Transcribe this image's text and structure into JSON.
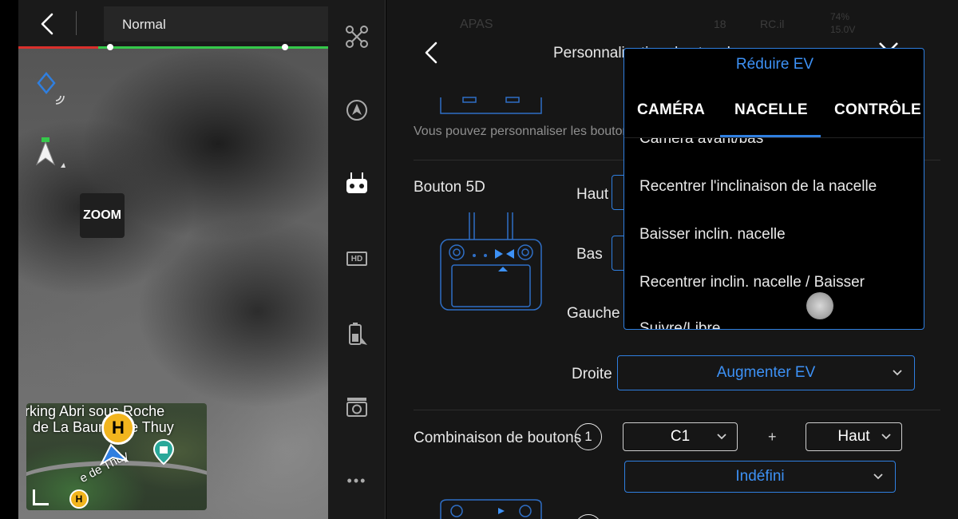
{
  "camera": {
    "flight_mode": "Normal",
    "zoom_label": "ZOOM"
  },
  "minimap": {
    "place_line1": "rking Abri sous Roche",
    "place_line2": "de La Baume de Thuy",
    "road_label": "e de Thuy",
    "home_marker": "H",
    "home_marker_small": "H"
  },
  "sidebar": {
    "items": [
      {
        "icon": "aircraft-icon"
      },
      {
        "icon": "obstacle-avoidance-icon"
      },
      {
        "icon": "remote-controller-icon"
      },
      {
        "icon": "hd-transmission-icon"
      },
      {
        "icon": "battery-icon"
      },
      {
        "icon": "camera-icon"
      },
      {
        "icon": "more-icon"
      }
    ],
    "hd_label": "HD",
    "more_label": "•••"
  },
  "status_strip": {
    "apas": "APAS",
    "signal": "18",
    "rc": "RC.il",
    "batt_top": "74%",
    "batt_bottom": "15.0V"
  },
  "settings": {
    "title": "Personnalisation des touches",
    "description": "Vous pouvez personnaliser les boutons",
    "section_5d": "Bouton 5D",
    "rows": {
      "up": "Haut",
      "down": "Bas",
      "left": "Gauche",
      "right": "Droite"
    },
    "right_value": "Augmenter EV",
    "combo_section": "Combinaison de boutons",
    "combo": {
      "number": "1",
      "button_a": "C1",
      "plus": "+",
      "button_b": "Haut",
      "action": "Indéfini"
    }
  },
  "dropdown": {
    "selected_value": "Réduire EV",
    "tabs": [
      "CAMÉRA",
      "NACELLE",
      "CONTRÔLE"
    ],
    "active_tab": "NACELLE",
    "options": [
      "Caméra avant/bas",
      "Recentrer l'inclinaison de la nacelle",
      "Baisser inclin. nacelle",
      "Recentrer inclin. nacelle / Baisser",
      "Suivre/Libre"
    ]
  },
  "colors": {
    "accent": "#2f7fe0",
    "accent_text": "#3d91f5",
    "status_red": "#d9302c",
    "status_green": "#35c94a",
    "marker_yellow": "#f2b51e"
  }
}
